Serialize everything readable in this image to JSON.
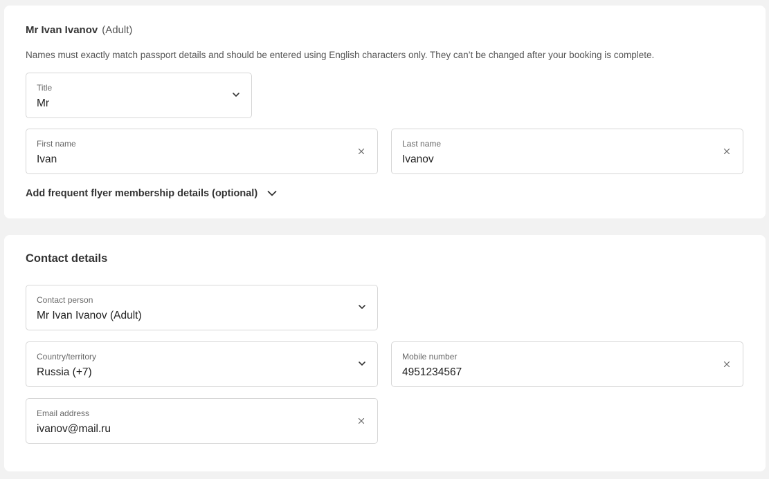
{
  "passenger": {
    "name": "Mr Ivan Ivanov",
    "type": "(Adult)",
    "note": "Names must exactly match passport details and should be entered using English characters only. They can’t be changed after your booking is complete.",
    "title_field": {
      "label": "Title",
      "value": "Mr",
      "icon": "chevron-down-icon"
    },
    "first_name_field": {
      "label": "First name",
      "value": "Ivan",
      "icon": "clear-icon"
    },
    "last_name_field": {
      "label": "Last name",
      "value": "Ivanov",
      "icon": "clear-icon"
    },
    "frequent_flyer_label": "Add frequent flyer membership details (optional)"
  },
  "contact": {
    "title": "Contact details",
    "contact_person_field": {
      "label": "Contact person",
      "value": "Mr Ivan Ivanov (Adult)",
      "icon": "chevron-down-icon"
    },
    "country_field": {
      "label": "Country/territory",
      "value": "Russia (+7)",
      "icon": "chevron-down-icon"
    },
    "mobile_field": {
      "label": "Mobile number",
      "value": "4951234567",
      "icon": "clear-icon"
    },
    "email_field": {
      "label": "Email address",
      "value": "ivanov@mail.ru",
      "icon": "clear-icon"
    }
  },
  "colors": {
    "page_background": "#f2f2f2",
    "card_background": "#ffffff",
    "field_border": "#d6d6d6",
    "text_primary": "#333333"
  }
}
